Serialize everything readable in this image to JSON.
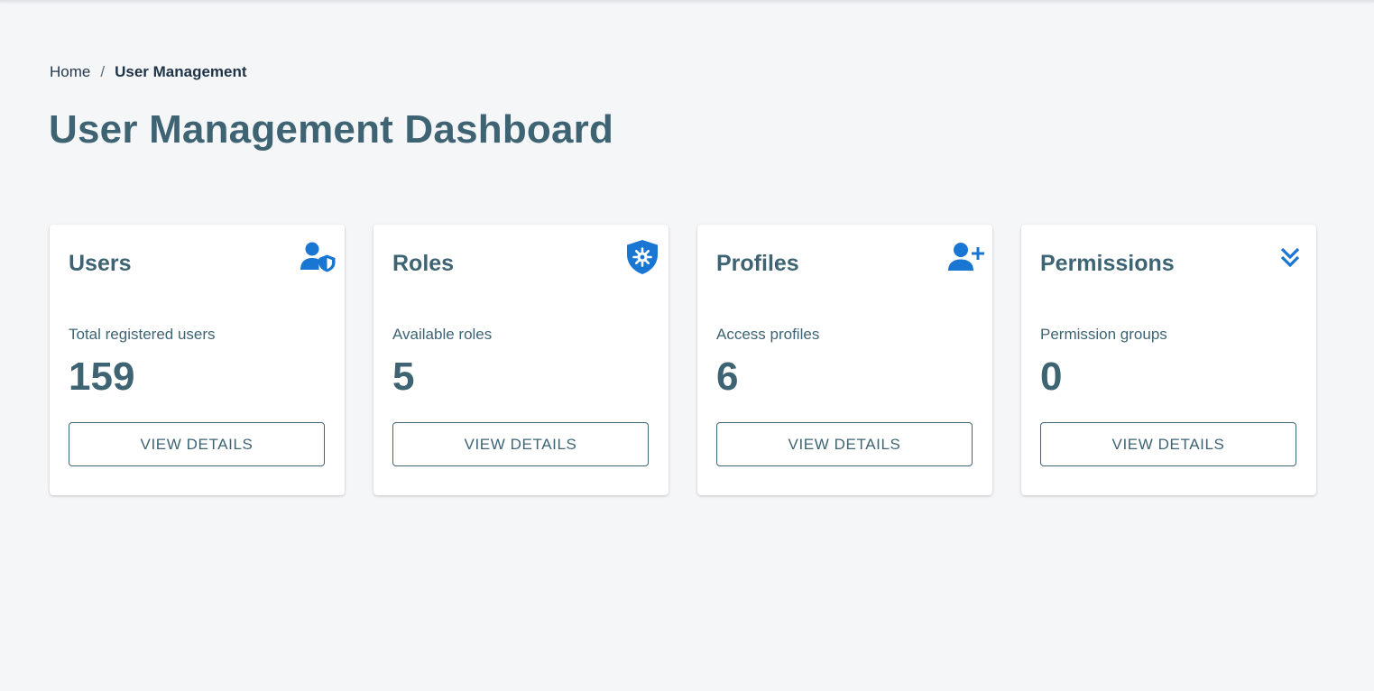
{
  "breadcrumb": {
    "home": "Home",
    "separator": "/",
    "current": "User Management"
  },
  "page": {
    "title": "User Management Dashboard"
  },
  "theme": {
    "background": "#f5f6f8",
    "text": "#3e6474",
    "icon_accent": "#1976d2",
    "card": "#ffffff"
  },
  "cards": [
    {
      "title": "Users",
      "icon": "user-shield-icon",
      "subtitle": "Total registered users",
      "value": "159",
      "button_label": "VIEW DETAILS"
    },
    {
      "title": "Roles",
      "icon": "shield-gear-icon",
      "subtitle": "Available roles",
      "value": "5",
      "button_label": "VIEW DETAILS"
    },
    {
      "title": "Profiles",
      "icon": "person-add-icon",
      "subtitle": "Access profiles",
      "value": "6",
      "button_label": "VIEW DETAILS"
    },
    {
      "title": "Permissions",
      "icon": "double-chevron-down-icon",
      "subtitle": "Permission groups",
      "value": "0",
      "button_label": "VIEW DETAILS"
    }
  ]
}
